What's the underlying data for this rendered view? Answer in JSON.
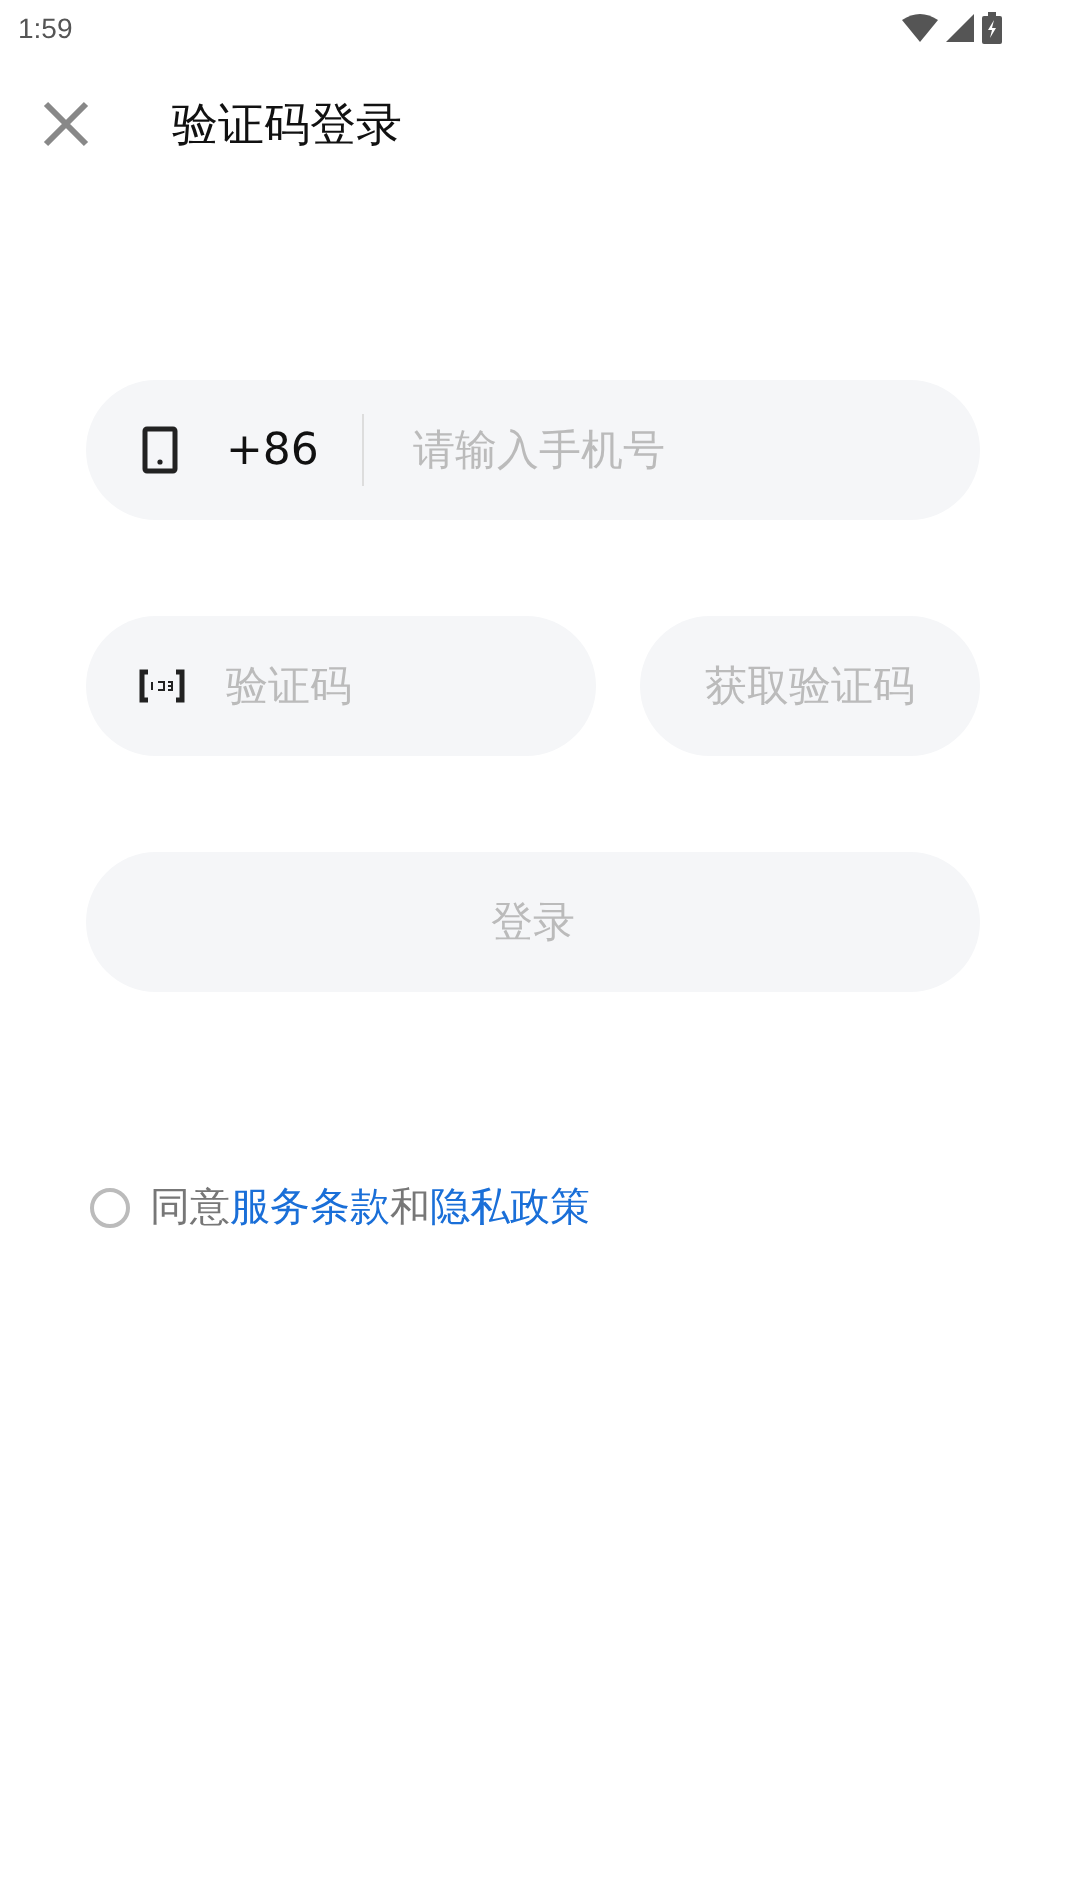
{
  "status_bar": {
    "time": "1:59"
  },
  "header": {
    "title": "验证码登录"
  },
  "phone": {
    "country_code": "+86",
    "placeholder": "请输入手机号"
  },
  "code": {
    "placeholder": "验证码",
    "send_button": {
      "label": "获取验证码",
      "disabled": true
    }
  },
  "login_button": {
    "label": "登录",
    "disabled": true
  },
  "agreement": {
    "checked": false,
    "parts": [
      {
        "kind": "text",
        "text": "同意"
      },
      {
        "kind": "link",
        "text": "服务条款"
      },
      {
        "kind": "text",
        "text": "和"
      },
      {
        "kind": "link",
        "text": "隐私政策"
      }
    ]
  }
}
